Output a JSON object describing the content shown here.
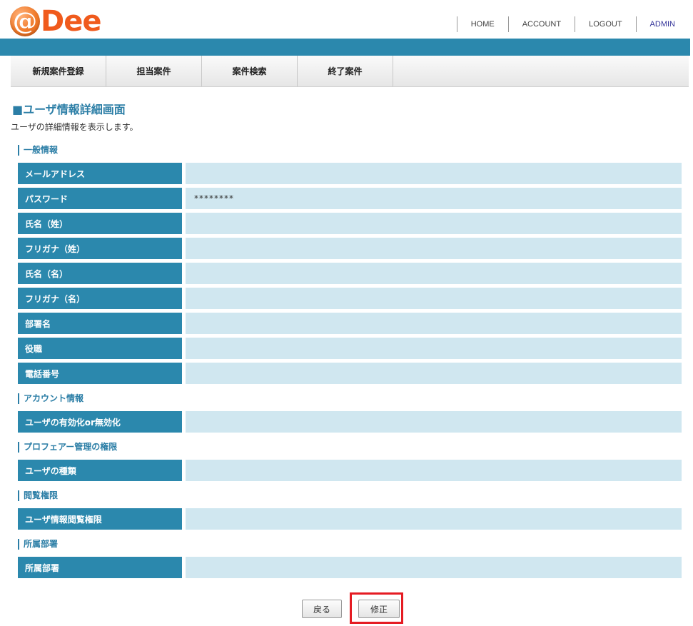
{
  "logo": {
    "at": "@",
    "text": "Dee"
  },
  "top_nav": [
    "HOME",
    "ACCOUNT",
    "LOGOUT",
    "ADMIN"
  ],
  "menu": [
    "新規案件登録",
    "担当案件",
    "案件検索",
    "終了案件"
  ],
  "page": {
    "title": "■ユーザ情報詳細画面",
    "description": "ユーザの詳細情報を表示します。"
  },
  "sections": {
    "general": {
      "heading": "一般情報",
      "rows": [
        {
          "label": "メールアドレス",
          "value": ""
        },
        {
          "label": "パスワード",
          "value": "********"
        },
        {
          "label": "氏名（姓）",
          "value": ""
        },
        {
          "label": "フリガナ（姓）",
          "value": ""
        },
        {
          "label": "氏名（名）",
          "value": ""
        },
        {
          "label": "フリガナ（名）",
          "value": ""
        },
        {
          "label": "部署名",
          "value": ""
        },
        {
          "label": "役職",
          "value": ""
        },
        {
          "label": "電話番号",
          "value": ""
        }
      ]
    },
    "account": {
      "heading": "アカウント情報",
      "rows": [
        {
          "label": "ユーザの有効化or無効化",
          "value": ""
        }
      ]
    },
    "profaire": {
      "heading": "プロフェアー管理の権限",
      "rows": [
        {
          "label": "ユーザの種類",
          "value": ""
        }
      ]
    },
    "browse": {
      "heading": "閲覧権限",
      "rows": [
        {
          "label": "ユーザ情報閲覧権限",
          "value": ""
        }
      ]
    },
    "department": {
      "heading": "所属部署",
      "rows": [
        {
          "label": "所属部署",
          "value": ""
        }
      ]
    }
  },
  "buttons": {
    "back": "戻る",
    "edit": "修正"
  },
  "colors": {
    "accent": "#2b88ad",
    "value_bg": "#d0e7f0",
    "logo": "#f05a1c",
    "highlight": "#e51c23"
  }
}
